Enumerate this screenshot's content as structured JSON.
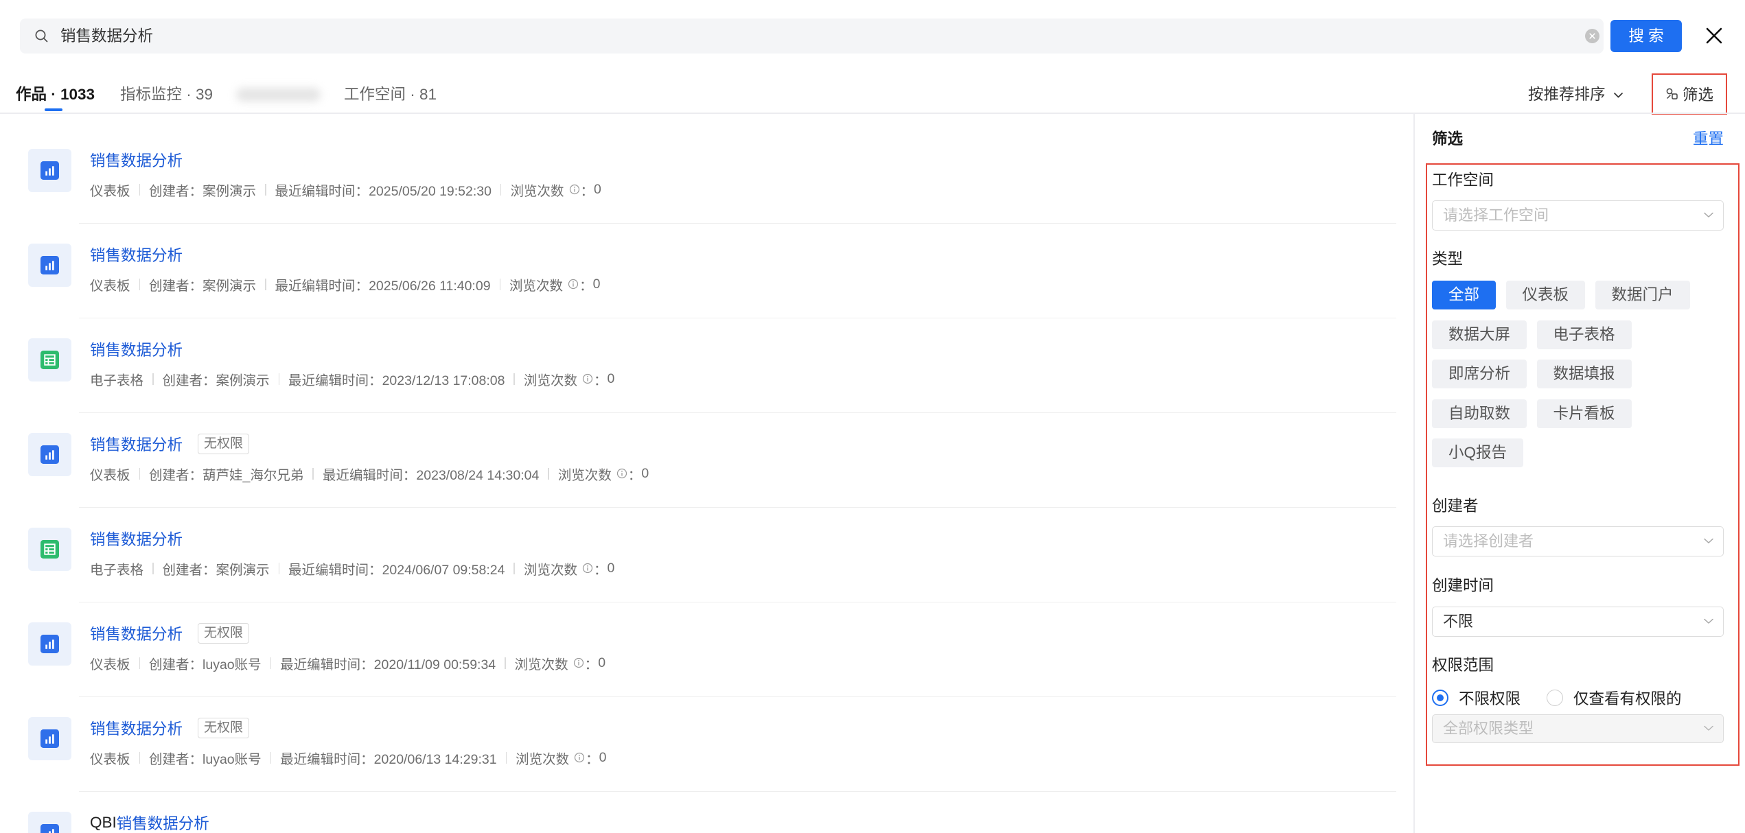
{
  "search": {
    "value": "销售数据分析",
    "button_label": "搜 索",
    "search_icon": "search-icon",
    "clear_icon": "clear-icon",
    "close_icon": "close-icon"
  },
  "tabs": [
    {
      "label": "作品 · 1033",
      "active": true
    },
    {
      "label": "指标监控 · 39",
      "active": false
    },
    {
      "label": "工作空间 · 81",
      "active": false
    }
  ],
  "sort": {
    "label": "按推荐排序",
    "icon": "chevron-down-icon"
  },
  "filter_toggle": {
    "label": "筛选",
    "icon": "filter-icon"
  },
  "meta_labels": {
    "creator": "创建者：",
    "edited": "最近编辑时间：",
    "views": "浏览次数",
    "views_colon": "：",
    "views_icon": "info-icon"
  },
  "results": [
    {
      "icon": "dashboard-icon",
      "title": "销售数据分析",
      "type": "仪表板",
      "creator": "案例演示",
      "edited": "2025/05/20 19:52:30",
      "views": "0"
    },
    {
      "icon": "dashboard-icon",
      "title": "销售数据分析",
      "type": "仪表板",
      "creator": "案例演示",
      "edited": "2025/06/26 11:40:09",
      "views": "0"
    },
    {
      "icon": "spreadsheet-icon",
      "title": "销售数据分析",
      "type": "电子表格",
      "creator": "案例演示",
      "edited": "2023/12/13 17:08:08",
      "views": "0"
    },
    {
      "icon": "dashboard-icon",
      "title": "销售数据分析",
      "badge": "无权限",
      "type": "仪表板",
      "creator": "葫芦娃_海尔兄弟",
      "edited": "2023/08/24 14:30:04",
      "views": "0"
    },
    {
      "icon": "spreadsheet-icon",
      "title": "销售数据分析",
      "type": "电子表格",
      "creator": "案例演示",
      "edited": "2024/06/07 09:58:24",
      "views": "0"
    },
    {
      "icon": "dashboard-icon",
      "title": "销售数据分析",
      "badge": "无权限",
      "type": "仪表板",
      "creator": "luyao账号",
      "edited": "2020/11/09 00:59:34",
      "views": "0"
    },
    {
      "icon": "dashboard-icon",
      "title": "销售数据分析",
      "badge": "无权限",
      "type": "仪表板",
      "creator": "luyao账号",
      "edited": "2020/06/13 14:29:31",
      "views": "0"
    },
    {
      "icon": "dashboard-icon",
      "title_prefix": "QBI",
      "title": "销售数据分析"
    }
  ],
  "filter_panel": {
    "title": "筛选",
    "reset_label": "重置",
    "workspace": {
      "label": "工作空间",
      "placeholder": "请选择工作空间"
    },
    "type": {
      "label": "类型",
      "options": [
        "全部",
        "仪表板",
        "数据门户",
        "数据大屏",
        "电子表格",
        "即席分析",
        "数据填报",
        "自助取数",
        "卡片看板",
        "小Q报告"
      ],
      "selected": "全部"
    },
    "creator": {
      "label": "创建者",
      "placeholder": "请选择创建者"
    },
    "created_time": {
      "label": "创建时间",
      "value": "不限"
    },
    "permission": {
      "label": "权限范围",
      "options": [
        {
          "label": "不限权限",
          "checked": true
        },
        {
          "label": "仅查看有权限的",
          "checked": false
        }
      ],
      "type_placeholder": "全部权限类型"
    }
  },
  "colors": {
    "accent": "#1e6ff1",
    "link": "#1d5bd6",
    "annotation": "#e5483b",
    "spreadsheet": "#2dbb6d",
    "dashboard": "#2f6fea"
  }
}
